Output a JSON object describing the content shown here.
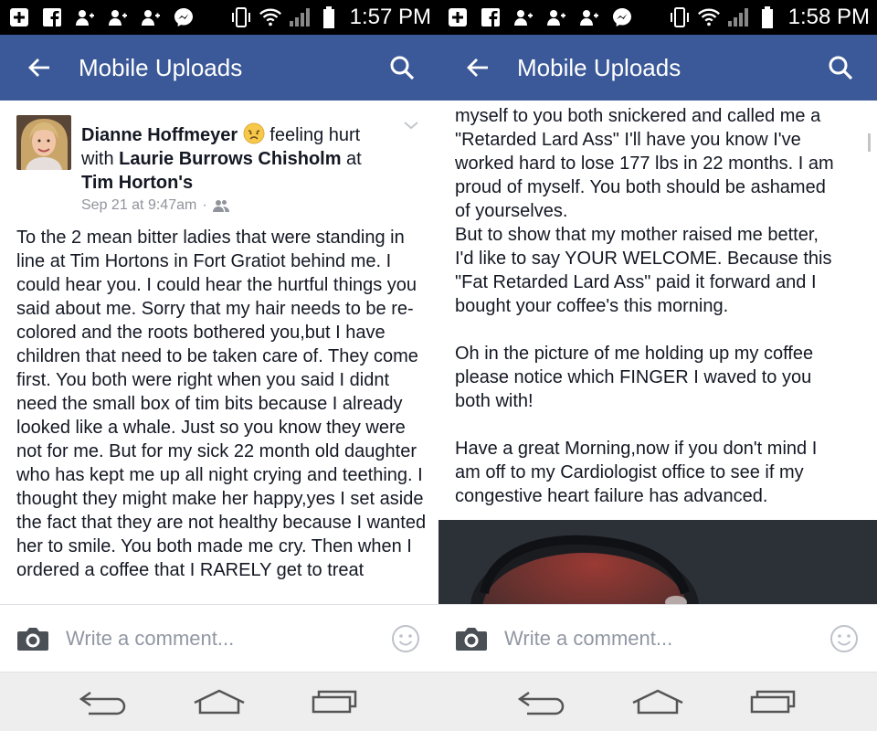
{
  "left": {
    "status_time": "1:57 PM",
    "app_title": "Mobile Uploads",
    "author_name": "Dianne Hoffmeyer",
    "feeling": " feeling hurt",
    "with_word": "with ",
    "tagged_name": "Laurie Burrows Chisholm",
    "at_word": " at",
    "place": "Tim Horton's",
    "timestamp": "Sep 21 at 9:47am",
    "separator": "·",
    "post_text": "To the 2 mean bitter ladies that were standing in line at Tim Hortons in Fort Gratiot behind me. I could hear you. I could hear the hurtful things you said about me. Sorry that my hair needs to be re-colored and the roots bothered you,but I have children that need to be taken care of. They come first. You both were right when you said I didnt need the small box of tim bits because I already looked like a whale. Just so you know they were not for me. But for my sick 22 month old daughter who has kept me up all night crying and teething. I thought they might make her happy,yes I set aside the fact that they are not healthy because I wanted her to smile. You both made me cry. Then when I ordered a coffee that I RARELY get to treat",
    "comment_placeholder": "Write a comment..."
  },
  "right": {
    "status_time": "1:58 PM",
    "app_title": "Mobile Uploads",
    "post_lines": [
      "myself to you both snickered and called me a",
      "\"Retarded Lard Ass\" I'll have you know I've",
      "worked hard to lose 177 lbs in 22 months. I am",
      "proud of myself. You both should be ashamed",
      "of yourselves.",
      "But to show that my mother raised me better,",
      "I'd like to say YOUR WELCOME. Because this",
      "\"Fat Retarded Lard Ass\" paid it forward and I",
      "bought your coffee's this morning.",
      "",
      "Oh in the picture of me holding up my coffee",
      "please notice which FINGER I waved to you",
      "both with!",
      "",
      "Have a great Morning,now if you don't mind I",
      "am off to my Cardiologist office to see if my",
      "congestive heart failure has advanced."
    ],
    "comment_placeholder": "Write a comment..."
  },
  "colors": {
    "app_bar": "#3b5998",
    "status_bar": "#000000",
    "text": "#141823",
    "muted": "#90949c"
  },
  "icons": [
    "add-box-icon",
    "facebook-icon",
    "people-icon",
    "messenger-icon",
    "vibrate-icon",
    "wifi-icon",
    "signal-icon",
    "battery-icon",
    "back-arrow-icon",
    "search-icon",
    "chevron-down-icon",
    "friends-audience-icon",
    "camera-icon",
    "smiley-icon",
    "nav-back-icon",
    "nav-home-icon",
    "nav-recents-icon"
  ]
}
